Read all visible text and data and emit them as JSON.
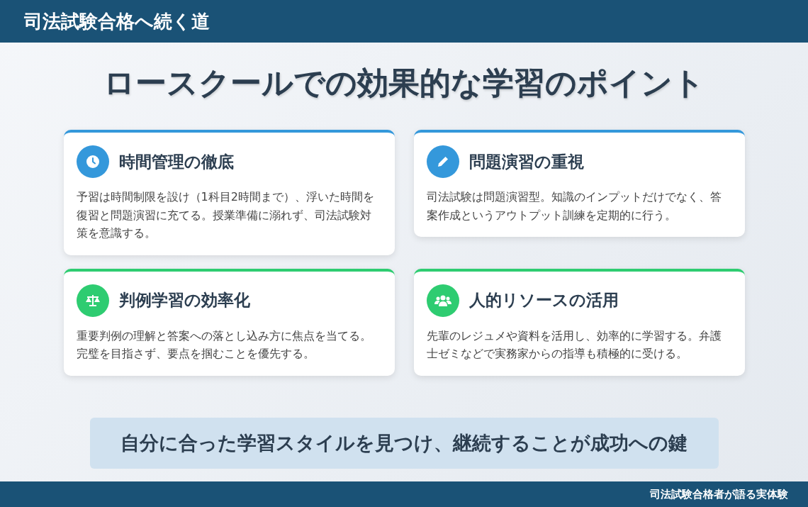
{
  "header": {
    "title": "司法試験合格へ続く道"
  },
  "heading": "ロースクールでの効果的な学習のポイント",
  "cards": [
    {
      "kind": "clock",
      "color": "#3498db",
      "title": "時間管理の徹底",
      "text": "予習は時間制限を設け（1科目2時間まで）、浮いた時間を復習と問題演習に充てる。授業準備に溺れず、司法試験対策を意識する。"
    },
    {
      "kind": "pencil",
      "color": "#3498db",
      "title": "問題演習の重視",
      "text": "司法試験は問題演習型。知識のインプットだけでなく、答案作成というアウトプット訓練を定期的に行う。"
    },
    {
      "kind": "scale",
      "color": "#2ecc71",
      "title": "判例学習の効率化",
      "text": "重要判例の理解と答案への落とし込み方に焦点を当てる。完璧を目指さず、要点を掴むことを優先する。"
    },
    {
      "kind": "people",
      "color": "#2ecc71",
      "title": "人的リソースの活用",
      "text": "先輩のレジュメや資料を活用し、効率的に学習する。弁護士ゼミなどで実務家からの指導も積極的に受ける。"
    }
  ],
  "banner": "自分に合った学習スタイルを見つけ、継続することが成功への鍵",
  "footer": "司法試験合格者が語る実体験"
}
